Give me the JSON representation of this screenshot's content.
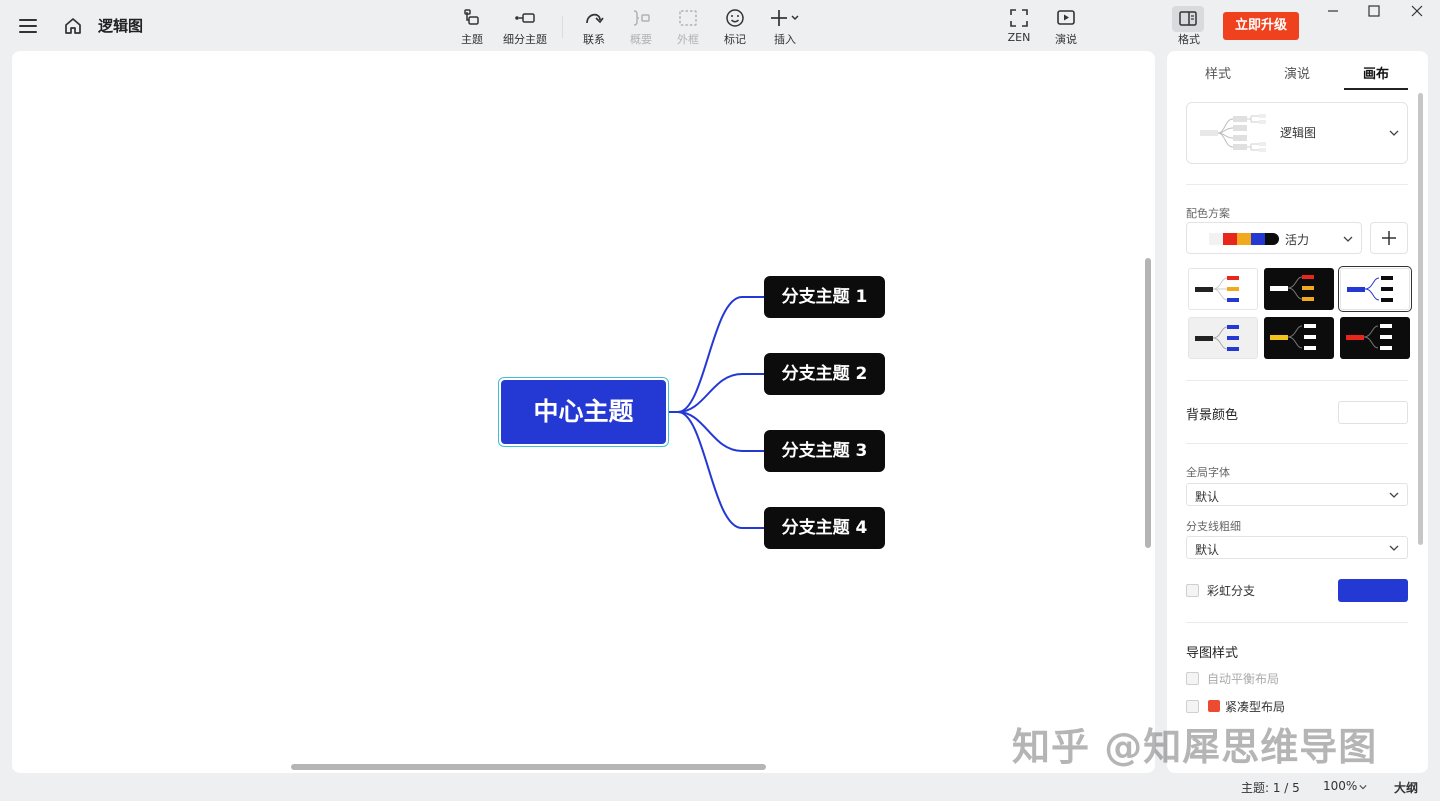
{
  "header": {
    "doc_title": "逻辑图",
    "tools": [
      {
        "label": "主题"
      },
      {
        "label": "细分主题"
      },
      {
        "label": "联系"
      },
      {
        "label": "概要"
      },
      {
        "label": "外框"
      },
      {
        "label": "标记"
      },
      {
        "label": "插入"
      }
    ],
    "view_tools": [
      {
        "label": "ZEN"
      },
      {
        "label": "演说"
      }
    ],
    "format_label": "格式",
    "upgrade_label": "立即升级"
  },
  "mindmap": {
    "central": "中心主题",
    "branches": [
      "分支主题 1",
      "分支主题 2",
      "分支主题 3",
      "分支主题 4"
    ],
    "colors": {
      "central": "#2439d4",
      "branch": "#0c0c0c",
      "line": "#2439d4",
      "selection": "#3fbfd6"
    }
  },
  "panel": {
    "tabs": [
      "样式",
      "演说",
      "画布"
    ],
    "active_tab": "画布",
    "structure": {
      "value": "逻辑图"
    },
    "color_scheme": {
      "label": "配色方案",
      "value": "活力",
      "swatches": [
        "#f2f2f2",
        "#e8261c",
        "#f2a91d",
        "#2439d4",
        "#0c0c0c"
      ]
    },
    "background": {
      "label": "背景颜色",
      "color": "#ffffff"
    },
    "global_font": {
      "label": "全局字体",
      "value": "默认"
    },
    "branch_width": {
      "label": "分支线粗细",
      "value": "默认"
    },
    "rainbow": {
      "label": "彩虹分支",
      "checked": false,
      "color": "#2439d4"
    },
    "map_style": {
      "label": "导图样式",
      "options": [
        {
          "label": "自动平衡布局",
          "checked": false
        },
        {
          "label": "紧凑型布局",
          "checked": false
        }
      ]
    }
  },
  "status": {
    "topics": "主题: 1 / 5",
    "zoom": "100%",
    "outline": "大纲"
  },
  "watermark": "知乎 @知犀思维导图"
}
